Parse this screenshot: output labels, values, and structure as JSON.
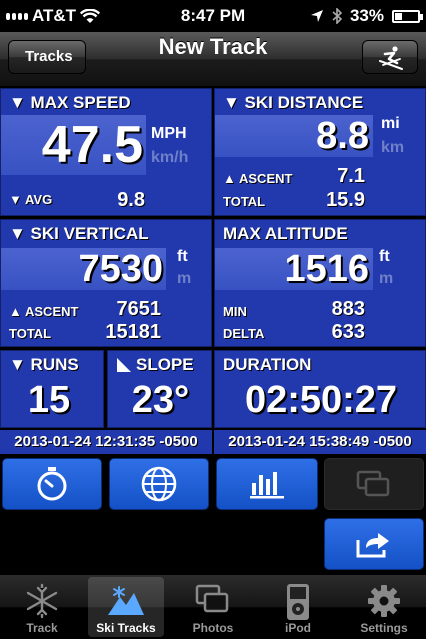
{
  "status": {
    "carrier": "AT&T",
    "time": "8:47 PM",
    "battery": "33%",
    "battery_level": 0.33
  },
  "nav": {
    "title": "New Track",
    "back_label": "Tracks",
    "action_icon": "skier-icon"
  },
  "max_speed": {
    "label": "▼ MAX SPEED",
    "value": "47.5",
    "unit_primary": "MPH",
    "unit_secondary": "km/h",
    "avg_label": "▼ AVG",
    "avg_value": "9.8"
  },
  "ski_distance": {
    "label": "▼ SKI DISTANCE",
    "value": "8.8",
    "unit_primary": "mi",
    "unit_secondary": "km",
    "ascent_label": "▲ ASCENT",
    "ascent_value": "7.1",
    "total_label": "TOTAL",
    "total_value": "15.9"
  },
  "ski_vertical": {
    "label": "▼ SKI VERTICAL",
    "value": "7530",
    "unit_primary": "ft",
    "unit_secondary": "m",
    "ascent_label": "▲ ASCENT",
    "ascent_value": "7651",
    "total_label": "TOTAL",
    "total_value": "15181"
  },
  "max_altitude": {
    "label": "MAX ALTITUDE",
    "value": "1516",
    "unit_primary": "ft",
    "unit_secondary": "m",
    "min_label": "MIN",
    "min_value": "883",
    "delta_label": "DELTA",
    "delta_value": "633"
  },
  "runs": {
    "label": "▼ RUNS",
    "value": "15"
  },
  "slope": {
    "label": "SLOPE",
    "value": "23°"
  },
  "duration": {
    "label": "DURATION",
    "value": "02:50:27"
  },
  "start_time": "2013-01-24 12:31:35 -0500",
  "end_time": "2013-01-24 15:38:49 -0500",
  "actions": [
    "stopwatch-icon",
    "globe-icon",
    "bar-chart-icon",
    "photos-icon",
    "share-icon"
  ],
  "tabs": [
    {
      "label": "Track",
      "icon": "snowflake-icon",
      "selected": false
    },
    {
      "label": "Ski Tracks",
      "icon": "mountain-icon",
      "selected": true
    },
    {
      "label": "Photos",
      "icon": "photos-icon",
      "selected": false
    },
    {
      "label": "iPod",
      "icon": "ipod-icon",
      "selected": false
    },
    {
      "label": "Settings",
      "icon": "gear-icon",
      "selected": false
    }
  ]
}
